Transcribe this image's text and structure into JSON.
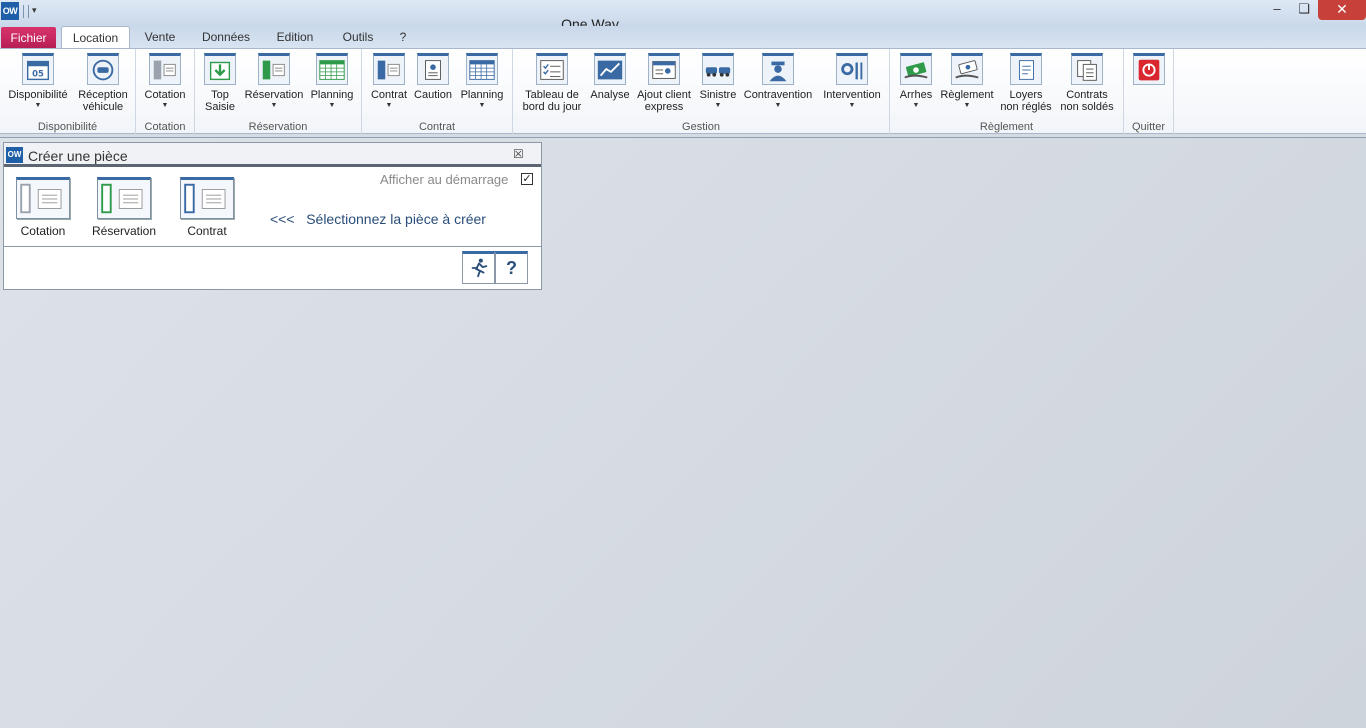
{
  "window": {
    "app_icon": "OW",
    "title": "One Way",
    "minimize": "–",
    "maximize": "❏",
    "close": "✕"
  },
  "tabs": [
    {
      "label": "Fichier"
    },
    {
      "label": "Location"
    },
    {
      "label": "Vente"
    },
    {
      "label": "Données"
    },
    {
      "label": "Edition"
    },
    {
      "label": "Outils"
    },
    {
      "label": "?"
    }
  ],
  "ribbon": {
    "groups": [
      {
        "label": "Disponibilité",
        "buttons": [
          {
            "label": "Disponibilité",
            "icon": "calendar-icon"
          },
          {
            "label": "Réception",
            "label2": "véhicule",
            "icon": "car-return-icon"
          }
        ]
      },
      {
        "label": "Cotation",
        "buttons": [
          {
            "label": "Cotation",
            "icon": "document-grey-icon"
          }
        ]
      },
      {
        "label": "Réservation",
        "buttons": [
          {
            "label": "Top",
            "label2": "Saisie",
            "icon": "download-icon"
          },
          {
            "label": "Réservation",
            "icon": "document-green-icon"
          },
          {
            "label": "Planning",
            "icon": "grid-green-icon"
          }
        ]
      },
      {
        "label": "Contrat",
        "buttons": [
          {
            "label": "Contrat",
            "icon": "document-blue-icon"
          },
          {
            "label": "Caution",
            "icon": "deposit-icon"
          },
          {
            "label": "Planning",
            "icon": "grid-blue-icon"
          }
        ]
      },
      {
        "label": "Gestion",
        "buttons": [
          {
            "label": "Tableau de",
            "label2": "bord du jour",
            "icon": "checklist-icon"
          },
          {
            "label": "Analyse",
            "icon": "chart-icon"
          },
          {
            "label": "Ajout client",
            "label2": "express",
            "icon": "client-card-icon"
          },
          {
            "label": "Sinistre",
            "icon": "crash-icon"
          },
          {
            "label": "Contravention",
            "icon": "officer-icon"
          },
          {
            "label": "Intervention",
            "icon": "tools-icon"
          }
        ]
      },
      {
        "label": "Règlement",
        "buttons": [
          {
            "label": "Arrhes",
            "icon": "money-icon"
          },
          {
            "label": "Règlement",
            "icon": "payment-icon"
          },
          {
            "label": "Loyers",
            "label2": "non réglés",
            "icon": "unpaid-icon"
          },
          {
            "label": "Contrats",
            "label2": "non soldés",
            "icon": "documents-icon"
          }
        ]
      },
      {
        "label": "Quitter",
        "buttons": [
          {
            "label": "",
            "icon": "power-icon"
          }
        ]
      }
    ]
  },
  "dialog": {
    "icon": "OW",
    "title": "Créer une pièce",
    "close": "☒",
    "startup_label": "Afficher au démarrage",
    "startup_checked": "✓",
    "pieces": [
      {
        "label": "Cotation",
        "color": "#9aa3ad"
      },
      {
        "label": "Réservation",
        "color": "#2e9a4a"
      },
      {
        "label": "Contrat",
        "color": "#3a6aa3"
      }
    ],
    "hint": "<<<   Sélectionnez la pièce à créer",
    "help": "?"
  }
}
